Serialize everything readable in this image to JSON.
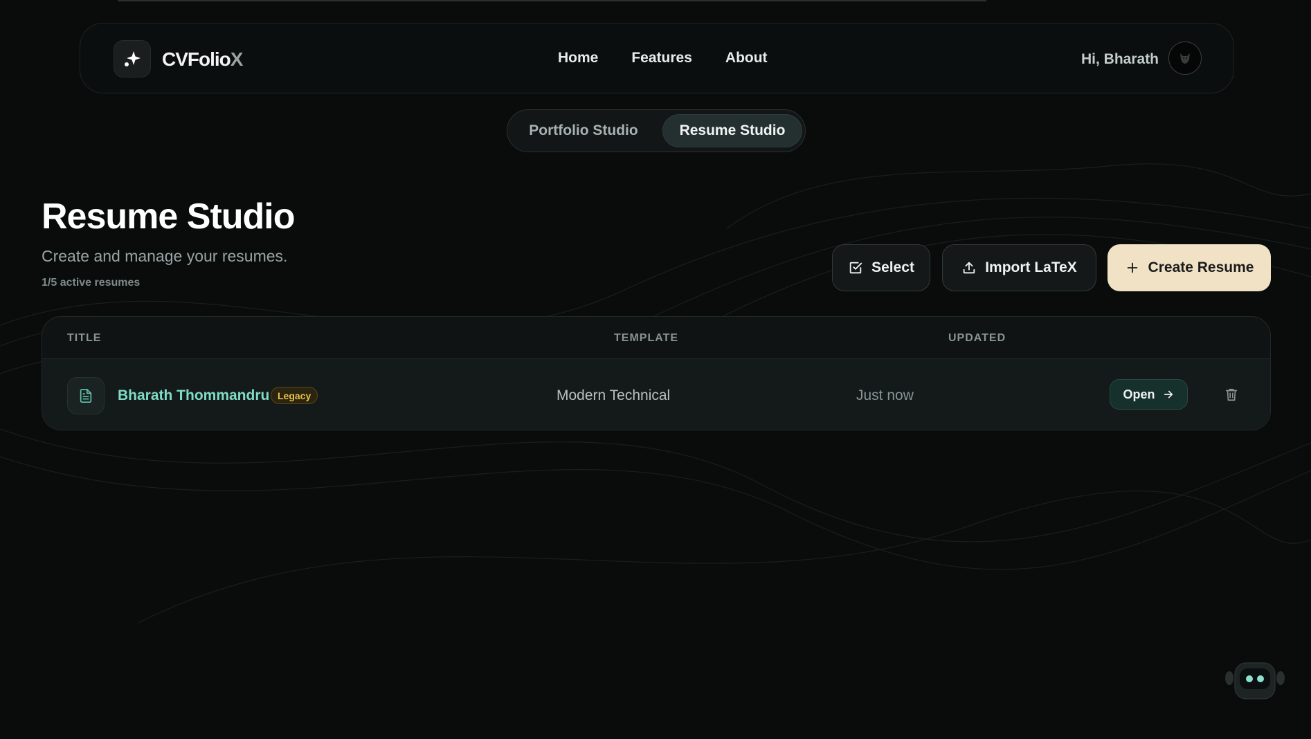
{
  "brand": {
    "name_main": "CVFolio",
    "name_suffix": "X"
  },
  "nav": {
    "links": [
      "Home",
      "Features",
      "About"
    ]
  },
  "user": {
    "greeting": "Hi, Bharath"
  },
  "tabs": [
    {
      "label": "Portfolio Studio",
      "active": false
    },
    {
      "label": "Resume Studio",
      "active": true
    }
  ],
  "header": {
    "title": "Resume Studio",
    "subtitle": "Create and manage your resumes.",
    "count": "1/5 active resumes"
  },
  "actions": {
    "select_label": "Select",
    "import_label": "Import LaTeX",
    "create_label": "Create Resume"
  },
  "table": {
    "columns": [
      "TITLE",
      "TEMPLATE",
      "UPDATED"
    ],
    "rows": [
      {
        "title": "Bharath Thommandru",
        "badge": "Legacy",
        "template": "Modern Technical",
        "updated": "Just now",
        "open_label": "Open"
      }
    ]
  },
  "colors": {
    "background": "#0a0c0c",
    "accent_teal": "#7fdcc6",
    "create_button": "#f1e2c6",
    "badge_yellow": "#e6c14a"
  },
  "icons": {
    "logo": "sparkle-icon",
    "select": "checkbox-icon",
    "import": "upload-icon",
    "create": "plus-icon",
    "file": "document-icon",
    "open": "arrow-right-icon",
    "delete": "trash-icon",
    "assistant": "robot-icon"
  }
}
